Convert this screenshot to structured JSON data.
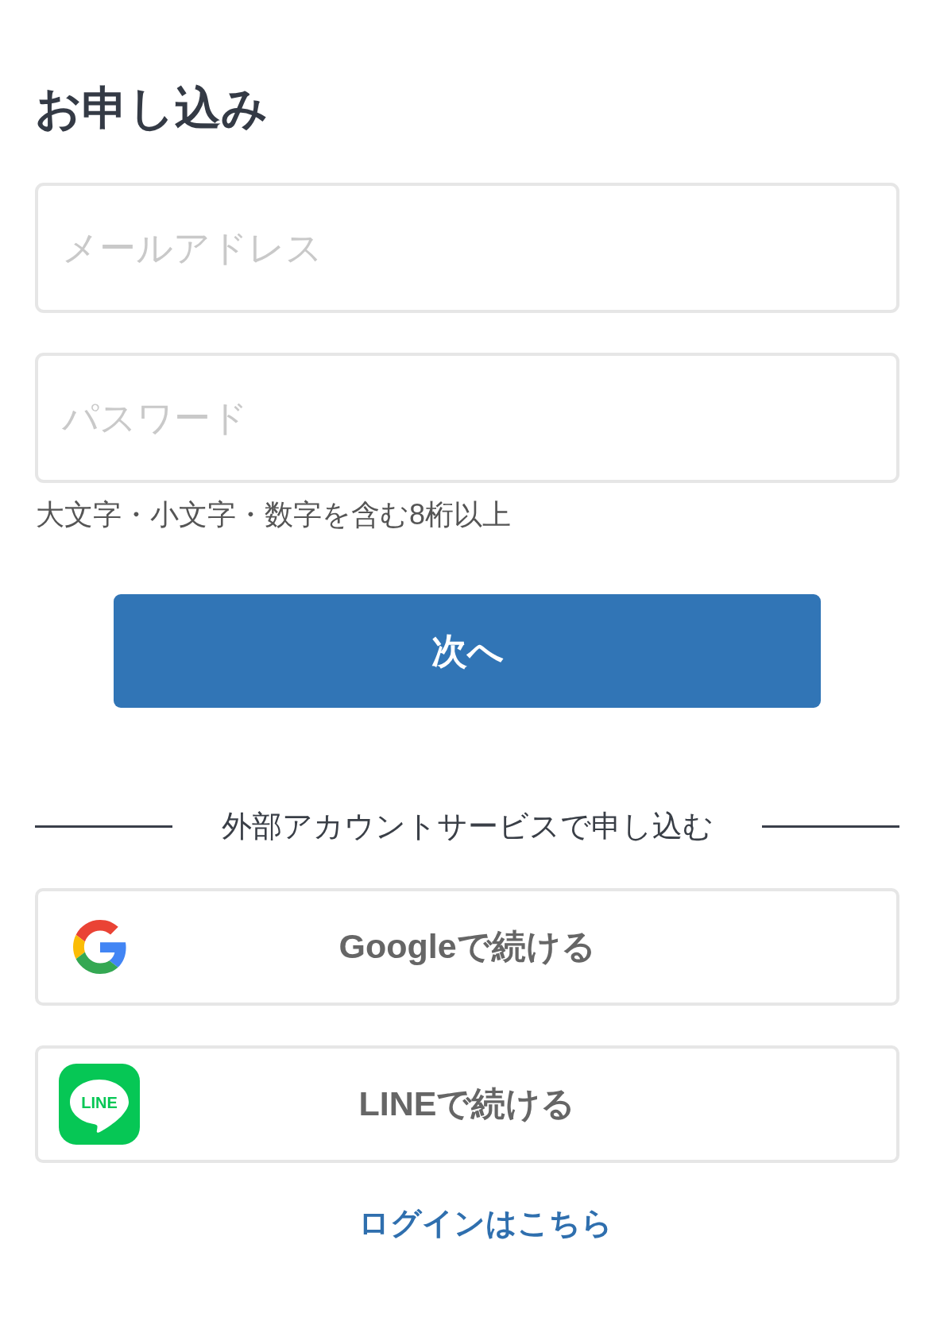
{
  "title": "お申し込み",
  "fields": [
    {
      "placeholder": "メールアドレス"
    },
    {
      "placeholder": "パスワード",
      "hint": "大文字・小文字・数字を含む8桁以上"
    }
  ],
  "next_button": {
    "label": "次へ"
  },
  "divider": {
    "label": "外部アカウントサービスで申し込む"
  },
  "social_buttons": [
    {
      "kind": "google",
      "label": "Googleで続ける"
    },
    {
      "kind": "line",
      "label": "LINEで続ける",
      "logo_text": "LINE"
    }
  ],
  "login_link": {
    "label": "ログインはこちら"
  }
}
